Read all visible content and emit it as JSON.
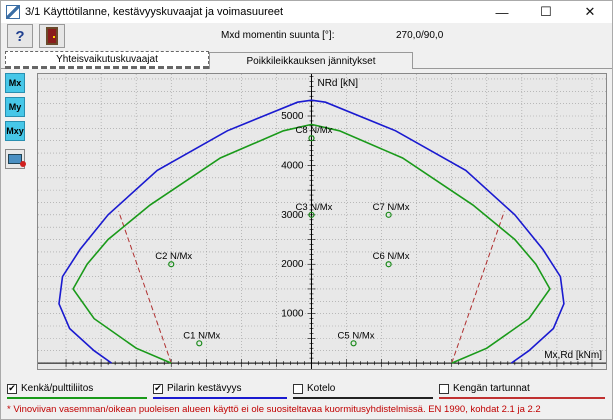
{
  "window": {
    "title": "3/1 Käyttötilanne, kestävyyskuvaajat ja voimasuureet",
    "minimize_glyph": "—",
    "maximize_glyph": "☐",
    "close_glyph": "✕"
  },
  "toolbar": {
    "help_label": "?",
    "direction_label": "Mxd momentin suunta [°]:",
    "direction_value": "270,0/90,0"
  },
  "tabs": [
    {
      "label": "Yhteisvaikutuskuvaajat",
      "active": true
    },
    {
      "label": "Poikkileikkauksen jännitykset",
      "active": false
    }
  ],
  "sidebar": {
    "buttons": [
      "Mx",
      "My",
      "Mxy"
    ],
    "print_icon": "printer-icon"
  },
  "legend": [
    {
      "label": "Kenkä/pulttiliitos",
      "checked": true,
      "color": "#1a9a1a"
    },
    {
      "label": "Pilarin kestävyys",
      "checked": true,
      "color": "#1a1ad0"
    },
    {
      "label": "Kotelo",
      "checked": false,
      "color": "#000000"
    },
    {
      "label": "Kengän tartunnat",
      "checked": false,
      "color": "#c03030"
    }
  ],
  "check_glyph": "✔",
  "note": "* Vinoviivan vasemman/oikean puoleisen alueen käyttö ei ole suositeltavaa kuormitusyhdistelmissä. EN 1990, kohdat 2.1 ja 2.2",
  "chart_data": {
    "type": "scatter",
    "xlabel": "Mx,Rd [kNm]",
    "ylabel": "NRd [kN]",
    "xlim": [
      -390,
      420
    ],
    "ylim": [
      -120,
      5850
    ],
    "x_ticks": [
      -300,
      -200,
      -100,
      0,
      100,
      200,
      300
    ],
    "y_ticks": [
      1000,
      2000,
      3000,
      4000,
      5000
    ],
    "grid": true,
    "series": [
      {
        "name": "Pilarin kestävyys",
        "color": "#1a1ad0",
        "x": [
          -285,
          -310,
          -345,
          -360,
          -355,
          -330,
          -290,
          -220,
          -120,
          -20,
          0,
          20,
          120,
          220,
          290,
          330,
          355,
          360,
          345,
          310,
          285
        ],
        "y": [
          0,
          250,
          700,
          1200,
          1750,
          2300,
          3000,
          3900,
          4700,
          5280,
          5320,
          5280,
          4700,
          3900,
          3000,
          2300,
          1750,
          1200,
          700,
          250,
          0
        ]
      },
      {
        "name": "Kenkä/pulttiliitos",
        "color": "#1a9a1a",
        "x": [
          -200,
          -250,
          -310,
          -340,
          -320,
          -290,
          -230,
          -130,
          -40,
          0,
          40,
          130,
          230,
          290,
          320,
          340,
          310,
          250,
          200
        ],
        "y": [
          0,
          300,
          900,
          1500,
          2000,
          2500,
          3200,
          4150,
          4700,
          4830,
          4700,
          4150,
          3200,
          2500,
          2000,
          1500,
          900,
          300,
          0
        ]
      }
    ],
    "dashed_lines": [
      {
        "x": [
          -200,
          -275
        ],
        "y": [
          0,
          3070
        ]
      },
      {
        "x": [
          200,
          275
        ],
        "y": [
          0,
          3070
        ]
      }
    ],
    "points": [
      {
        "label": "C8 N/Mx",
        "x": 0,
        "y": 4550
      },
      {
        "label": "C3 N/Mx",
        "x": 0,
        "y": 3000
      },
      {
        "label": "C7 N/Mx",
        "x": 110,
        "y": 3000
      },
      {
        "label": "C2 N/Mx",
        "x": -200,
        "y": 2000
      },
      {
        "label": "C6 N/Mx",
        "x": 110,
        "y": 2000
      },
      {
        "label": "C1 N/Mx",
        "x": -160,
        "y": 400
      },
      {
        "label": "C5 N/Mx",
        "x": 60,
        "y": 400
      }
    ]
  }
}
